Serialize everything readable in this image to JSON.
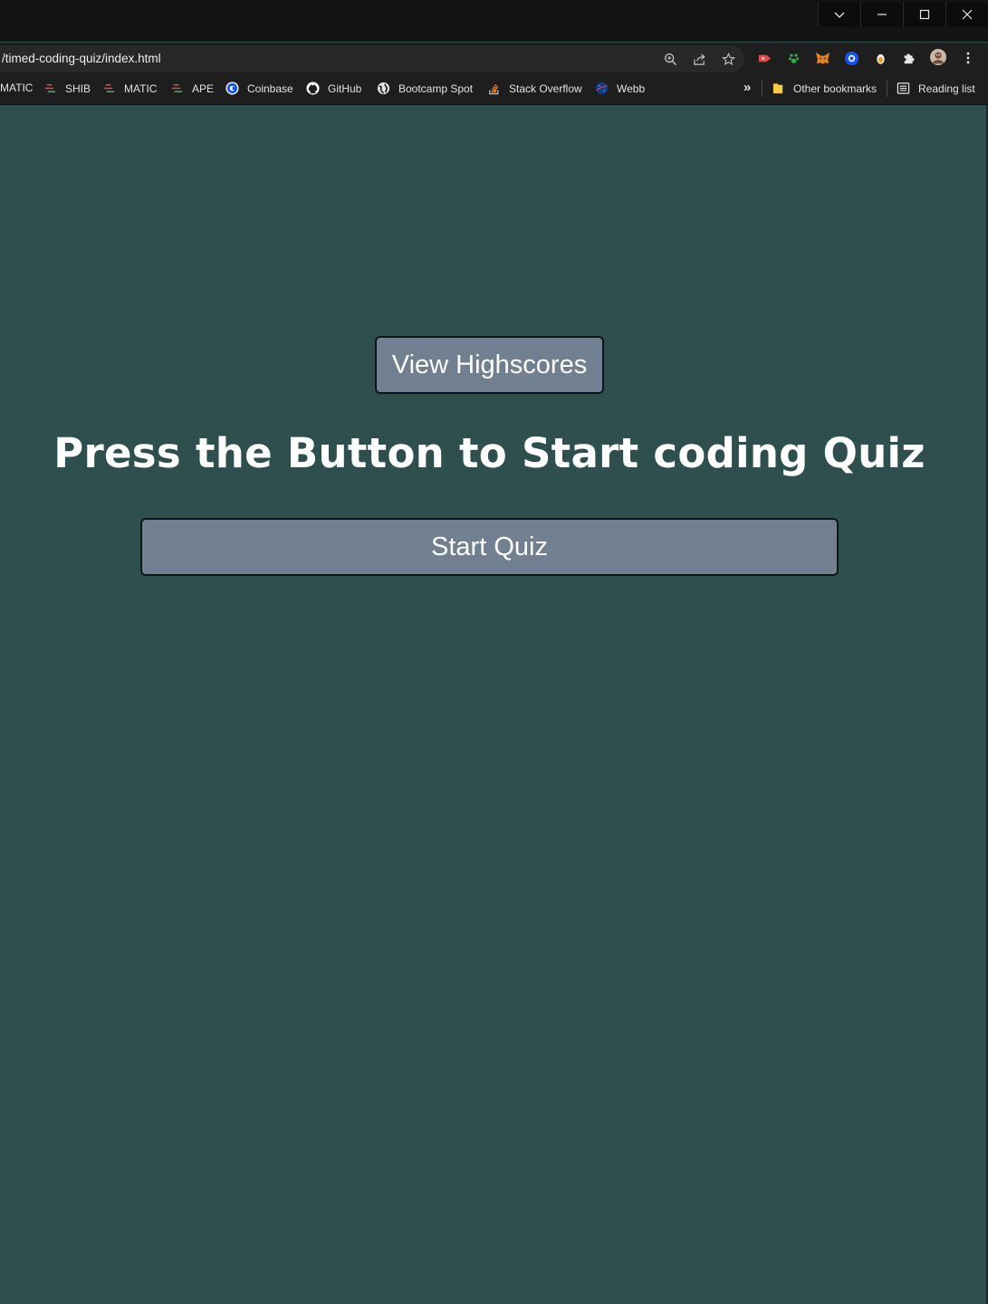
{
  "browser": {
    "url": "/timed-coding-quiz/index.html",
    "window_controls": {
      "dropdown_icon": "chevron-down-icon",
      "minimize_icon": "minimize-icon",
      "maximize_icon": "maximize-icon",
      "close_icon": "close-icon"
    },
    "bookmarks": [
      {
        "label": "MATIC",
        "icon": "chart-icon"
      },
      {
        "label": "SHIB",
        "icon": "chart-icon"
      },
      {
        "label": "MATIC",
        "icon": "chart-icon"
      },
      {
        "label": "APE",
        "icon": "chart-icon"
      },
      {
        "label": "Coinbase",
        "icon": "coinbase-icon"
      },
      {
        "label": "GitHub",
        "icon": "github-icon"
      },
      {
        "label": "Bootcamp Spot",
        "icon": "globe-icon"
      },
      {
        "label": "Stack Overflow",
        "icon": "stackoverflow-icon"
      },
      {
        "label": "Webb",
        "icon": "nasa-icon"
      }
    ],
    "more_bookmarks": "»",
    "other_bookmarks": "Other bookmarks",
    "reading_list": "Reading list"
  },
  "page": {
    "background_color": "#2f4f4f",
    "button_color": "#708090",
    "highscores_button": "View Highscores",
    "headline": "Press the Button to Start coding Quiz",
    "start_button": "Start Quiz"
  }
}
